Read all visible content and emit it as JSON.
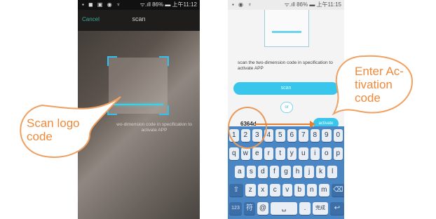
{
  "left_phone": {
    "status_left_icons": "▪ ◼ ▣ ◉ ♆",
    "status_right": "ᯤ.ıll 86% ▬ 上午11:12",
    "cancel_label": "Cancel",
    "title": "scan",
    "instruction": "wo-dimension code in specification to activate APP"
  },
  "right_phone": {
    "status_left_icons": "▪ ◉ ♆",
    "status_right": "ᯤ.ıll 86% ▬ 上午11:15",
    "instruction": "scan the two-dimension code in specification to activate APP",
    "scan_button": "scan",
    "or_label": "or",
    "code_value": "6364d",
    "activate_button": "activate",
    "keyboard": {
      "row1": [
        "1",
        "2",
        "3",
        "4",
        "5",
        "6",
        "7",
        "8",
        "9",
        "0"
      ],
      "row2": [
        "q",
        "w",
        "e",
        "r",
        "t",
        "y",
        "u",
        "i",
        "o",
        "p"
      ],
      "row3": [
        "a",
        "s",
        "d",
        "f",
        "g",
        "h",
        "j",
        "k",
        "l"
      ],
      "row4": [
        "⇧",
        "z",
        "x",
        "c",
        "v",
        "b",
        "n",
        "m",
        "⌫"
      ],
      "row5": [
        "123",
        "符",
        "@",
        "␣",
        ".",
        "完成",
        "↩"
      ]
    }
  },
  "callouts": {
    "scan_logo": [
      "Scan logo",
      "code"
    ],
    "enter_activation": [
      "Enter Ac-",
      "tivation",
      "code"
    ]
  },
  "colors": {
    "callout_stroke": "#f0a060",
    "callout_text": "#f08a3a",
    "accent_blue": "#38c6ec",
    "keyboard_bg": "#4b86c4"
  }
}
